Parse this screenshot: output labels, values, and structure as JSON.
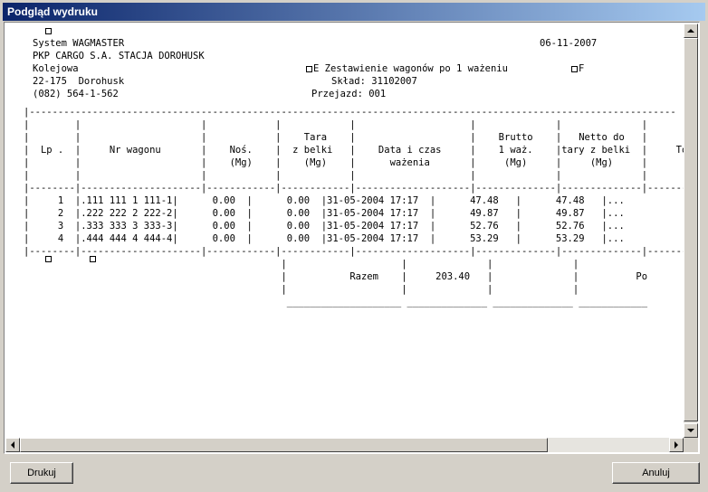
{
  "window": {
    "title": "Podgląd wydruku"
  },
  "report": {
    "header": {
      "system": "System WAGMASTER",
      "date": "06-11-2007",
      "company": "PKP CARGO S.A. STACJA DOROHUSK",
      "street": "Kolejowa",
      "report_title": "E Zestawienie wagonów po 1 ważeniu",
      "flag": "F",
      "postcode": "22-175  Dorohusk",
      "sklad": "Skład: 31102007",
      "phone": "(082) 564-1-562",
      "przejazd": "Przejazd: 001"
    },
    "table_lines": [
      "|-----------------------------------------------------------------------------------------------------------------",
      "|        |                     |            |            |                    |              |              |",
      "|        |                     |            |    Tara    |                    |    Brutto    |   Netto do   |",
      "|  Lp .  |     Nr wagonu       |    Noś.    |  z belki   |    Data i czas     |    1 waż.    |tary z belki  |     Towar",
      "|        |                     |    (Mg)    |    (Mg)    |      ważenia       |     (Mg)     |     (Mg)     |",
      "|        |                     |            |            |                    |              |              |",
      "|--------|---------------------|------------|------------|--------------------|--------------|--------------|---------",
      "|     1  |.111 111 1 111-1|      0.00  |      0.00  |31-05-2004 17:17  |      47.48   |      47.48   |...",
      "|     2  |.222 222 2 222-2|      0.00  |      0.00  |31-05-2004 17:17  |      49.87   |      49.87   |...",
      "|     3  |.333 333 3 333-3|      0.00  |      0.00  |31-05-2004 17:17  |      52.76   |      52.76   |...",
      "|     4  |.444 444 4 444-4|      0.00  |      0.00  |31-05-2004 17:17  |      53.29   |      53.29   |...",
      "|--------|---------------------|------------|------------|--------------------|--------------|--------------|---------",
      "                                             |                    |              |              |",
      "                                             |           Razem    |     203.40   |              |          Po",
      "                                             |                    |              |              |",
      "                                              ____________________ ______________ ______________ ____________"
    ]
  },
  "buttons": {
    "print": "Drukuj",
    "cancel": "Anuluj"
  }
}
